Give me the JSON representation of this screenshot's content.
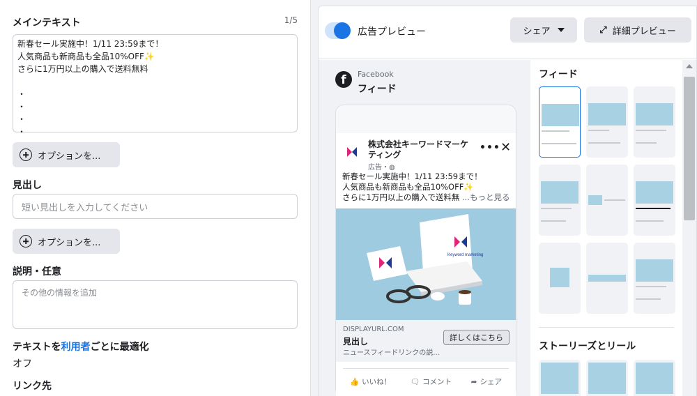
{
  "editor": {
    "main_text_label": "メインテキスト",
    "main_text_counter": "1/5",
    "main_text_lines": [
      "新春セール実施中！1/11 23:59まで！",
      "人気商品も新商品も全品10%OFF✨",
      "さらに1万円以上の購入で送料無料",
      "",
      "・",
      "・",
      "・",
      "・"
    ],
    "options_label": "オプションを...",
    "headline_label": "見出し",
    "headline_placeholder": "短い見出しを入力してください",
    "desc_label": "説明・任意",
    "desc_placeholder": "その他の情報を追加",
    "optimize_label_pre": "テキストを",
    "optimize_label_link": "利用者",
    "optimize_label_post": "ごとに最適化",
    "optimize_value": "オフ",
    "link_label": "リンク先"
  },
  "preview": {
    "toggle_label": "広告プレビュー",
    "share_label": "シェア",
    "detail_label": "詳細プレビュー",
    "platform": "Facebook",
    "placement": "フィード",
    "company_name": "株式会社キーワードマーケティング",
    "ad_tag": "広告・",
    "ad_lines": [
      "新春セール実施中！1/11 23:59まで！",
      "人気商品も新商品も全品10%OFF✨",
      "さらに1万円以上の購入で送料無"
    ],
    "see_more": "...もっと見る",
    "display_url": "DISPLAYURL.COM",
    "headline": "見出し",
    "description": "ニュースフィードリンクの説...",
    "cta": "詳しくはこちら",
    "like": "いいね！",
    "comment": "コメント",
    "share": "シェア",
    "image_logo_text": "Keyword marketing"
  },
  "placements": {
    "feed_title": "フィード",
    "stories_title": "ストーリーズとリール"
  },
  "colors": {
    "accent": "#1b74e4",
    "image_bg": "#9fcbe0"
  }
}
